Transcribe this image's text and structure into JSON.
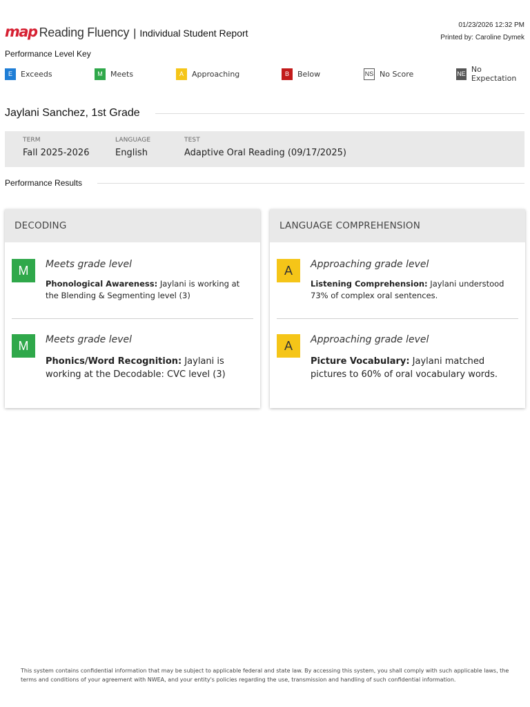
{
  "header": {
    "logo_map": "map",
    "logo_product": "Reading Fluency",
    "separator": "|",
    "report_title": "Individual Student Report",
    "datetime": "01/23/2026 12:32 PM",
    "printed_by": "Printed by: Caroline Dymek"
  },
  "key": {
    "title": "Performance Level Key",
    "items": [
      {
        "badge": "E",
        "label": "Exceeds",
        "color": "#1f7ed6"
      },
      {
        "badge": "M",
        "label": "Meets",
        "color": "#2fa84a"
      },
      {
        "badge": "A",
        "label": "Approaching",
        "color": "#f5c518"
      },
      {
        "badge": "B",
        "label": "Below",
        "color": "#c21a1a"
      },
      {
        "badge": "NS",
        "label": "No Score",
        "color": "#ffffff"
      },
      {
        "badge": "NE",
        "label": "No Expectation",
        "color": "#555555"
      }
    ]
  },
  "student": {
    "name": "Jaylani Sanchez, 1st Grade"
  },
  "info": {
    "term_label": "TERM",
    "term_value": "Fall 2025-2026",
    "language_label": "LANGUAGE",
    "language_value": "English",
    "test_label": "TEST",
    "test_value": "Adaptive Oral Reading (09/17/2025)"
  },
  "results": {
    "title": "Performance Results"
  },
  "cards": [
    {
      "title": "DECODING",
      "items": [
        {
          "badge": "M",
          "badge_color": "#2fa84a",
          "level": "Meets grade level",
          "skill": "Phonological Awareness:",
          "text": " Jaylani is working at the Blending & Segmenting level (3)"
        },
        {
          "badge": "M",
          "badge_color": "#2fa84a",
          "level": "Meets grade level",
          "skill": "Phonics/Word Recognition:",
          "text": " Jaylani is working at the Decodable: CVC level (3)"
        }
      ]
    },
    {
      "title": "LANGUAGE COMPREHENSION",
      "items": [
        {
          "badge": "A",
          "badge_color": "#f5c518",
          "level": "Approaching grade level",
          "skill": "Listening Comprehension:",
          "text": " Jaylani understood 73% of complex oral sentences."
        },
        {
          "badge": "A",
          "badge_color": "#f5c518",
          "level": "Approaching grade level",
          "skill": "Picture Vocabulary:",
          "text": " Jaylani matched pictures to 60% of oral vocabulary words."
        }
      ]
    }
  ],
  "footer": {
    "text": "This system contains confidential information that may be subject to applicable federal and state law. By accessing this system, you shall comply with such applicable laws, the terms and conditions of your agreement with NWEA, and your entity's policies regarding the use, transmission and handling of such confidential information."
  }
}
